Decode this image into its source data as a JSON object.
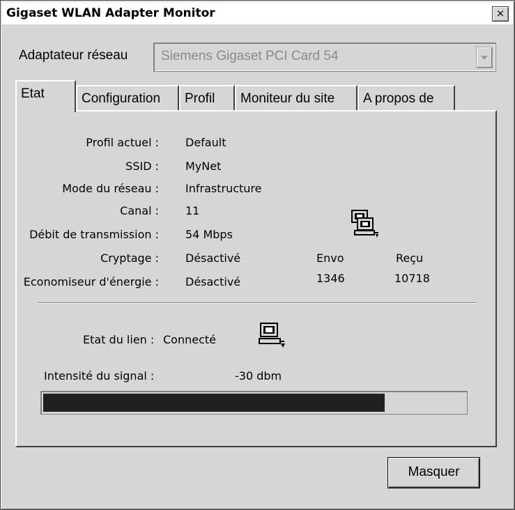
{
  "window": {
    "title": "Gigaset WLAN Adapter Monitor",
    "close_label": "×"
  },
  "adapter": {
    "label": "Adaptateur réseau",
    "selected": "Siemens Gigaset PCI Card 54"
  },
  "tabs": [
    {
      "label": "Etat",
      "active": true
    },
    {
      "label": "Configuration",
      "active": false
    },
    {
      "label": "Profil",
      "active": false
    },
    {
      "label": "Moniteur du site",
      "active": false
    },
    {
      "label": "A propos de",
      "active": false
    }
  ],
  "status": {
    "fields": [
      {
        "label": "Profil actuel :",
        "value": "Default"
      },
      {
        "label": "SSID :",
        "value": "MyNet"
      },
      {
        "label": "Mode du réseau :",
        "value": "Infrastructure"
      },
      {
        "label": "Canal :",
        "value": "11"
      },
      {
        "label": "Débit de transmission :",
        "value": "54 Mbps"
      },
      {
        "label": "Cryptage :",
        "value": "Désactivé"
      },
      {
        "label": "Economiseur d'énergie :",
        "value": "Désactivé"
      }
    ],
    "traffic": {
      "icon": "network-computer-icon",
      "sent_label": "Envo",
      "sent_value": "1346",
      "received_label": "Reçu",
      "received_value": "10718"
    }
  },
  "link": {
    "label": "Etat du lien :",
    "value": "Connecté",
    "icon": "network-computer-icon"
  },
  "signal": {
    "label": "Intensité du signal :",
    "value": "-30 dbm",
    "fill_fraction": 0.81,
    "fill_color": "#202020"
  },
  "buttons": {
    "hide_label": "Masquer"
  }
}
